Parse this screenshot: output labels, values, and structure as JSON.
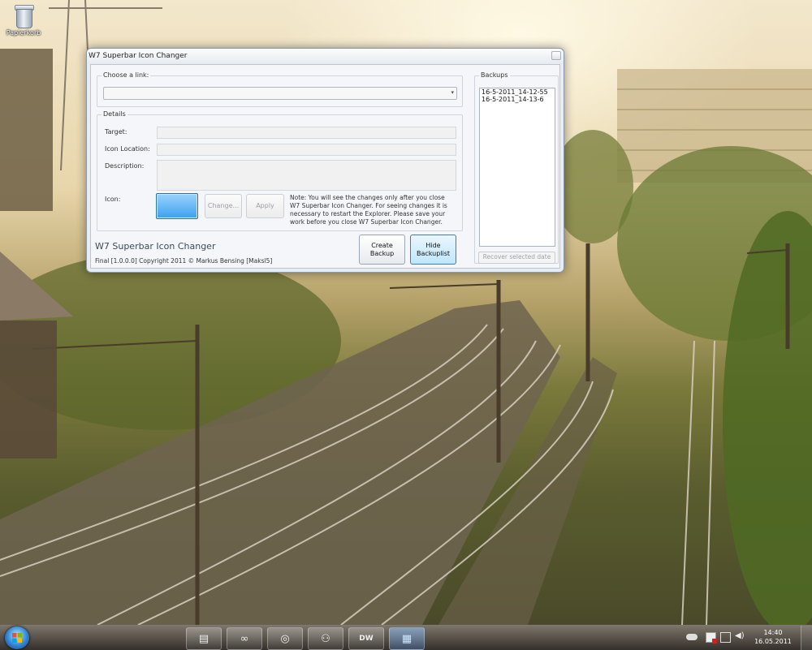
{
  "desktop": {
    "icon_label": "Papierkorb"
  },
  "window": {
    "title": "W7 Superbar Icon Changer",
    "choose_link_legend": "Choose a link:",
    "details_legend": "Details",
    "labels": {
      "target": "Target:",
      "icon_location": "Icon Location:",
      "description": "Description:",
      "icon": "Icon:"
    },
    "buttons": {
      "change": "Change...",
      "apply": "Apply",
      "create_backup_line1": "Create",
      "create_backup_line2": "Backup",
      "hide_backuplist_line1": "Hide",
      "hide_backuplist_line2": "Backuplist"
    },
    "note_lines": [
      "Note: You will see the changes only after you close",
      "W7 Superbar Icon Changer. For seeing changes it is",
      "necessary to restart the Explorer. Please save your",
      "work before you close W7 Superbar Icon Changer."
    ],
    "app_name": "W7 Superbar Icon Changer",
    "footer": "Final [1.0.0.0] Copyright 2011 © Markus Bensing [Maksl5]",
    "backups_legend": "Backups",
    "backups": [
      "16-5-2011_14-12-55",
      "16-5-2011_14-13-6"
    ],
    "recover_button": "Recover selected date"
  },
  "taskbar": {
    "start_icon": "windows-orb",
    "pinned": [
      {
        "name": "explorer-icon",
        "glyph": "▤"
      },
      {
        "name": "infinity-icon",
        "glyph": "∞"
      },
      {
        "name": "chrome-icon",
        "glyph": "◎"
      },
      {
        "name": "users-icon",
        "glyph": "⚇"
      },
      {
        "name": "dreamweaver-icon",
        "glyph": "DW"
      },
      {
        "name": "superbar-changer-icon",
        "glyph": "▦"
      }
    ],
    "clock_time": "14:40",
    "clock_date": "16.05.2011"
  }
}
